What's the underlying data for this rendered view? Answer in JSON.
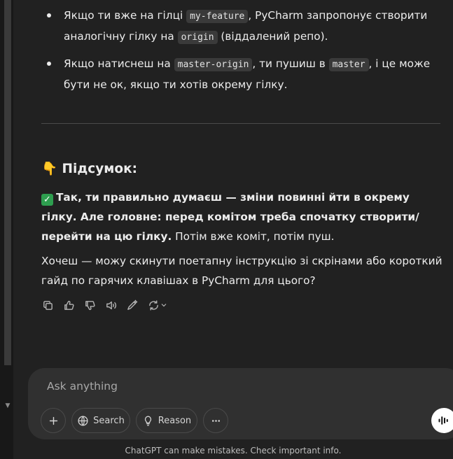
{
  "bullets": [
    {
      "pre": "Якщо ти вже на гілці ",
      "code": "my-feature",
      "mid": ", PyCharm запропонує створити аналогічну гілку на ",
      "code2": "origin",
      "post": " (віддалений репо)."
    },
    {
      "pre": "Якщо натиснеш на ",
      "code": "master-origin",
      "mid": ", ти пушиш в ",
      "code2": "master",
      "post": ", і це може бути не ок, якщо ти хотів окрему гілку."
    }
  ],
  "summary": {
    "emoji": "👇",
    "title": "Підсумок:"
  },
  "para1": {
    "bold": "Так, ти правильно думаєш — зміни повинні йти в окрему гілку. Але головне: перед комітом треба спочатку створити/перейти на цю гілку.",
    "rest": " Потім вже коміт, потім пуш."
  },
  "para2": "Хочеш — можу скинути поетапну інструкцію зі скрінами або короткий гайд по гарячих клавішах в PyCharm для цього?",
  "composer": {
    "placeholder": "Ask anything",
    "search_label": "Search",
    "reason_label": "Reason"
  },
  "disclaimer": "ChatGPT can make mistakes. Check important info.",
  "icons": [
    "copy-icon",
    "thumbs-up-icon",
    "thumbs-down-icon",
    "speaker-icon",
    "edit-icon",
    "regenerate-icon",
    "chevron-down-icon",
    "plus-icon",
    "globe-icon",
    "lightbulb-icon",
    "ellipsis-icon",
    "voice-icon"
  ]
}
